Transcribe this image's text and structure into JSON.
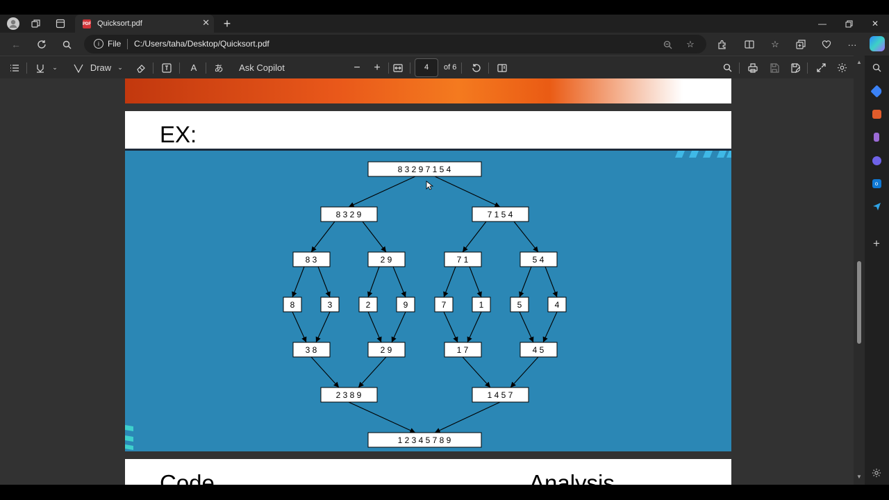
{
  "tab": {
    "title": "Quicksort.pdf",
    "pdf_badge": "PDF"
  },
  "address": {
    "scheme_label": "File",
    "url": "C:/Users/taha/Desktop/Quicksort.pdf"
  },
  "toolbar": {
    "draw_label": "Draw",
    "ask_copilot_label": "Ask Copilot",
    "read_aloud_glyph": "A",
    "translate_glyph": "あ",
    "page_current": "4",
    "page_of": "of 6"
  },
  "slide": {
    "title": "EX:",
    "diagram_title": "8 3 2 9 7 1 5 4",
    "level1": [
      "8 3 2 9",
      "7 1 5 4"
    ],
    "level2": [
      "8 3",
      "2 9",
      "7 1",
      "5 4"
    ],
    "level3": [
      "8",
      "3",
      "2",
      "9",
      "7",
      "1",
      "5",
      "4"
    ],
    "level4": [
      "3 8",
      "2 9",
      "1 7",
      "4 5"
    ],
    "level5": [
      "2 3 8 9",
      "1 4 5 7"
    ],
    "result": "1 2 3 4 5 7 8 9"
  },
  "next_page": {
    "left_heading": "Code",
    "right_heading": "Analysis"
  },
  "colors": {
    "slide_blue": "#2b87b5",
    "chrome_dark": "#2b2b2b",
    "tab_strip": "#202020"
  },
  "icons": [
    "profile-icon",
    "workspaces-icon",
    "tab-actions-icon",
    "pdf-icon",
    "close-icon",
    "plus-icon",
    "minimize-icon",
    "restore-icon",
    "back-icon",
    "refresh-icon",
    "search-icon",
    "info-icon",
    "zoom-icon",
    "star-icon",
    "extensions-icon",
    "split-screen-icon",
    "favorites-icon",
    "collections-icon",
    "heart-icon",
    "more-icon",
    "copilot-icon",
    "contents-icon",
    "highlight-icon",
    "draw-icon",
    "eraser-icon",
    "text-icon",
    "read-aloud-icon",
    "translate-icon",
    "zoom-out-icon",
    "zoom-in-icon",
    "fit-page-icon",
    "rotate-icon",
    "page-view-icon",
    "print-icon",
    "save-icon",
    "save-as-icon",
    "fullscreen-icon",
    "settings-icon"
  ]
}
